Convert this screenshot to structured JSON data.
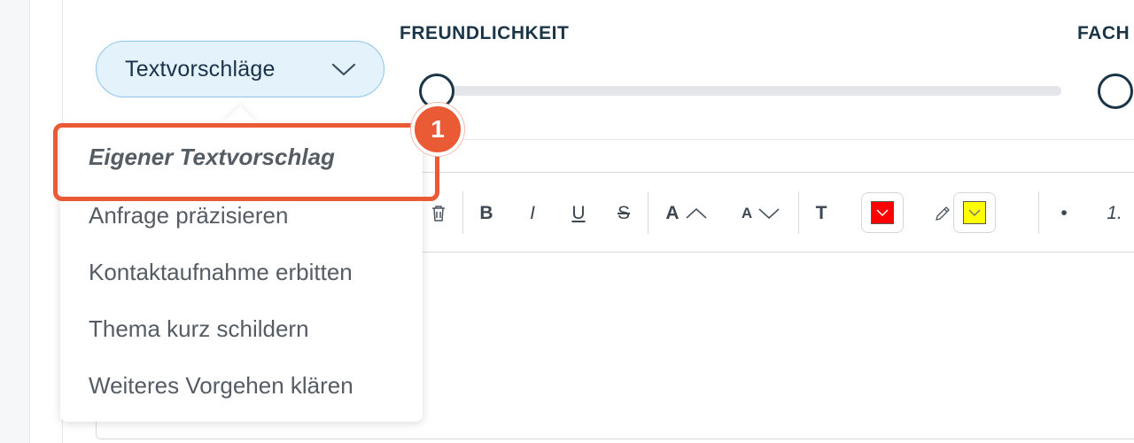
{
  "dropdown": {
    "label": "Textvorschläge",
    "icon": "chevron-down-icon"
  },
  "sliders": [
    {
      "label": "FREUNDLICHKEIT",
      "value_fraction": 0.0
    },
    {
      "label": "FACH",
      "value_fraction": 0.0
    }
  ],
  "menu": {
    "items": [
      {
        "label": "Eigener Textvorschlag"
      },
      {
        "label": "Anfrage präzisieren"
      },
      {
        "label": "Kontaktaufnahme erbitten"
      },
      {
        "label": "Thema kurz schildern"
      },
      {
        "label": "Weiteres Vorgehen klären"
      }
    ]
  },
  "annotation": {
    "badge_number": "1",
    "color": "#ea5a35"
  },
  "toolbar": {
    "delete_icon": "trash-icon",
    "bold": "B",
    "italic": "I",
    "underline": "U",
    "strike": "S",
    "font_size_up": "A",
    "font_size_down": "A",
    "text_style": "T",
    "text_color": "#ff0000",
    "highlight_color": "#ffff00",
    "bullet": "•",
    "ordered": "1."
  }
}
